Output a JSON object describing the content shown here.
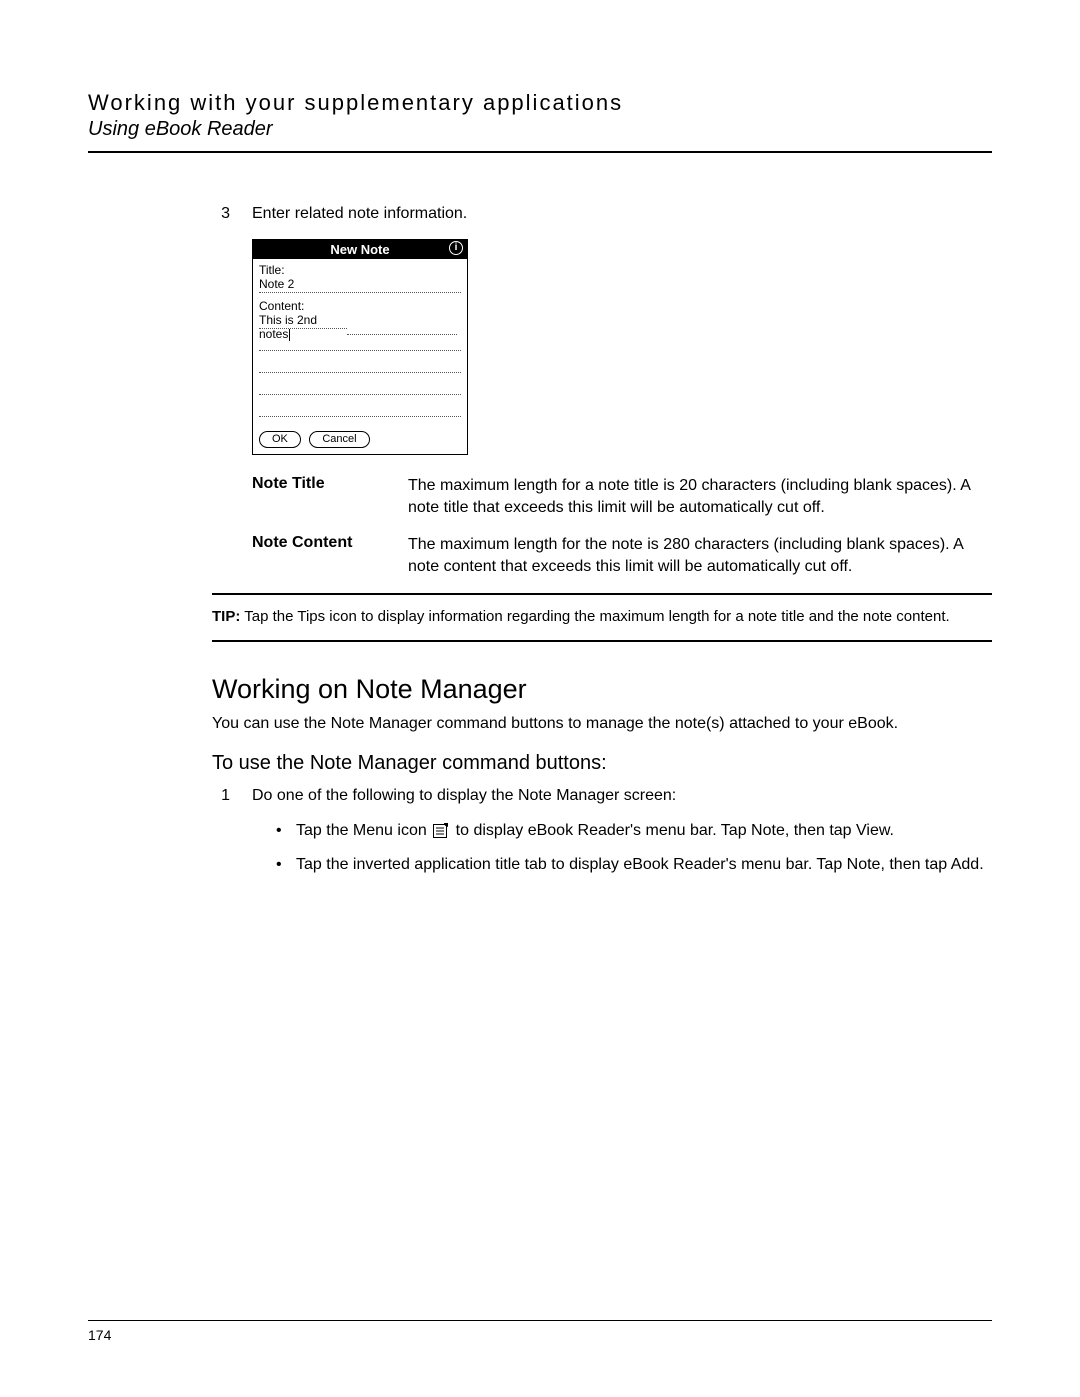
{
  "header": {
    "title": "Working with your supplementary applications",
    "subtitle": "Using eBook Reader"
  },
  "step3": {
    "num": "3",
    "text": "Enter related note information."
  },
  "newnote": {
    "title": "New Note",
    "label_title": "Title:",
    "field_title": "Note 2",
    "label_content": "Content:",
    "field_content": "This is 2nd notes",
    "ok": "OK",
    "cancel": "Cancel"
  },
  "defs": {
    "note_title": {
      "term": "Note Title",
      "body": "The maximum length for a note title is 20 characters (including blank spaces). A note title that exceeds this limit will be automatically cut off."
    },
    "note_content": {
      "term": "Note Content",
      "body": "The maximum length for the note is 280 characters (including blank spaces). A note content that exceeds this limit will be automatically cut off."
    }
  },
  "tip": {
    "label": "TIP:",
    "text": "Tap the Tips icon to display information regarding the maximum length for a note title and the note content."
  },
  "section": {
    "h": "Working on Note Manager",
    "p": "You can use the Note Manager command buttons to manage the note(s) attached to your eBook."
  },
  "subh": "To use the Note Manager command buttons:",
  "step1": {
    "num": "1",
    "text": "Do one of the following to display the Note Manager screen:"
  },
  "bullets": {
    "b1a": "Tap the Menu icon ",
    "b1b": " to display eBook Reader's menu bar. Tap Note, then tap View.",
    "b2": "Tap the inverted application title tab to display eBook Reader's menu bar. Tap Note, then tap Add."
  },
  "footer": {
    "page": "174"
  }
}
